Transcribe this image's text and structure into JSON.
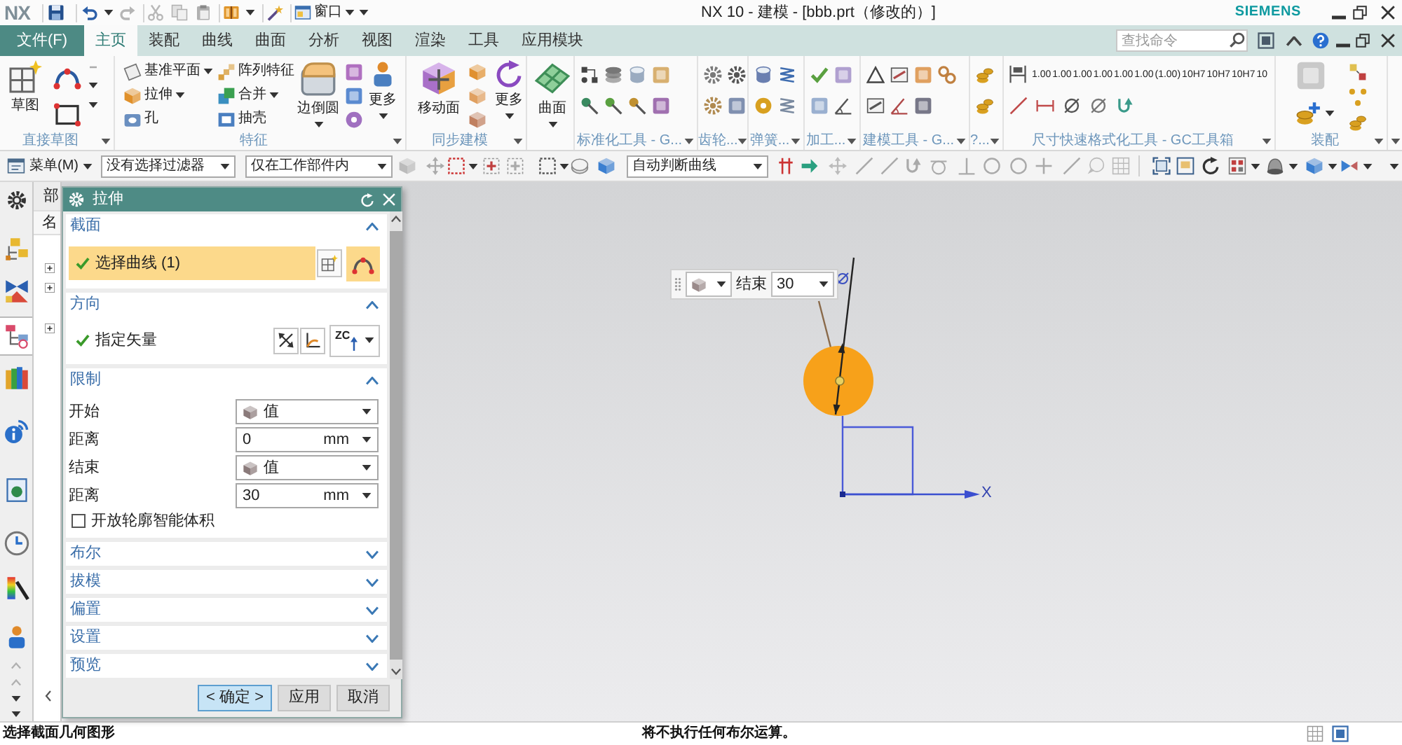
{
  "title_bar": {
    "logo": "NX",
    "window_menu": "窗口",
    "title": "NX 10 - 建模 - [bbb.prt（修改的）]",
    "brand": "SIEMENS"
  },
  "menu_bar": {
    "file_button": "文件(F)",
    "tabs": [
      {
        "label": "主页",
        "selected": true
      },
      {
        "label": "装配",
        "selected": false
      },
      {
        "label": "曲线",
        "selected": false
      },
      {
        "label": "曲面",
        "selected": false
      },
      {
        "label": "分析",
        "selected": false
      },
      {
        "label": "视图",
        "selected": false
      },
      {
        "label": "渲染",
        "selected": false
      },
      {
        "label": "工具",
        "selected": false
      },
      {
        "label": "应用模块",
        "selected": false
      }
    ],
    "search": {
      "placeholder": "查找命令"
    }
  },
  "ribbon": {
    "groups": [
      {
        "kind": "sketch",
        "label": "直接草图",
        "button": "草图"
      },
      {
        "kind": "feature",
        "label": "特征",
        "small_buttons": [
          {
            "label": "基准平面",
            "dropdown": true
          },
          {
            "label": "拉伸",
            "dropdown": true
          },
          {
            "label": "孔",
            "dropdown": false
          },
          {
            "label": "阵列特征",
            "dropdown": false
          },
          {
            "label": "合并",
            "dropdown": true
          },
          {
            "label": "抽壳",
            "dropdown": false
          }
        ],
        "big_buttons": [
          {
            "label": "边倒圆",
            "dropdown": true
          },
          {
            "label": "更多",
            "dropdown": true
          }
        ]
      },
      {
        "kind": "sync",
        "label": "同步建模",
        "big_buttons": [
          {
            "label": "移动面",
            "dropdown": false
          },
          {
            "label": "更多",
            "dropdown": true
          }
        ]
      },
      {
        "kind": "surface",
        "big_buttons": [
          {
            "label": "曲面",
            "dropdown": true
          }
        ]
      },
      {
        "kind": "icons",
        "label": "标准化工具 - G..."
      },
      {
        "kind": "icons",
        "label": "齿轮..."
      },
      {
        "kind": "icons",
        "label": "弹簧..."
      },
      {
        "kind": "icons",
        "label": "加工..."
      },
      {
        "kind": "icons",
        "label": "建模工具 - G..."
      },
      {
        "kind": "icons",
        "label": "?..."
      },
      {
        "kind": "format",
        "label": "尺寸快速格式化工具 - GC工具箱",
        "format_buttons": [
          "1.00",
          "1.00",
          "1.00",
          "1.00",
          "1.00",
          "1.00",
          "(1.00)",
          "10H7",
          "10H7",
          "10H7",
          "10"
        ]
      },
      {
        "kind": "assembly",
        "label": "装配"
      }
    ]
  },
  "toolbar": {
    "menu_button": "菜单(M)",
    "filter": "没有选择过滤器",
    "scope": "仅在工作部件内",
    "curve_rule": "自动判断曲线"
  },
  "resource_bar": {
    "tabs": [
      {
        "selected": false
      },
      {
        "selected": false
      },
      {
        "selected": true
      },
      {
        "selected": false
      },
      {
        "selected": false
      },
      {
        "selected": false
      },
      {
        "selected": false
      },
      {
        "selected": false
      },
      {
        "selected": false
      }
    ]
  },
  "part_navigator": {
    "title": "部",
    "column_1": "名"
  },
  "dialog": {
    "title": "拉伸",
    "sections": [
      {
        "kind": "selection",
        "title": "截面",
        "expanded": true,
        "row": {
          "label": "选择曲线 (1)",
          "done": true,
          "active": true
        }
      },
      {
        "kind": "vector",
        "title": "方向",
        "expanded": true,
        "row": {
          "label": "指定矢量",
          "done": true,
          "active": false
        },
        "vector_choice": "ZC"
      },
      {
        "kind": "limits",
        "title": "限制",
        "expanded": true,
        "fields": [
          {
            "label": "开始",
            "kind": "select",
            "value": "值"
          },
          {
            "label": "距离",
            "kind": "number",
            "value": "0",
            "unit": "mm"
          },
          {
            "label": "结束",
            "kind": "select",
            "value": "值"
          },
          {
            "label": "距离",
            "kind": "number",
            "value": "30",
            "unit": "mm"
          }
        ],
        "checkbox": {
          "label": "开放轮廓智能体积",
          "checked": false
        }
      },
      {
        "title": "布尔",
        "expanded": false
      },
      {
        "title": "拔模",
        "expanded": false
      },
      {
        "title": "偏置",
        "expanded": false
      },
      {
        "title": "设置",
        "expanded": false
      },
      {
        "title": "预览",
        "expanded": false
      }
    ],
    "buttons": [
      {
        "label": "< 确定 >",
        "selected": true
      },
      {
        "label": "应用",
        "selected": false
      },
      {
        "label": "取消",
        "selected": false
      }
    ]
  },
  "float_bar": {
    "label": "结束",
    "value": "30"
  },
  "canvas": {
    "axis_label": "X"
  },
  "status_bar": {
    "prompt": "选择截面几何图形",
    "message": "将不执行任何布尔运算。"
  }
}
